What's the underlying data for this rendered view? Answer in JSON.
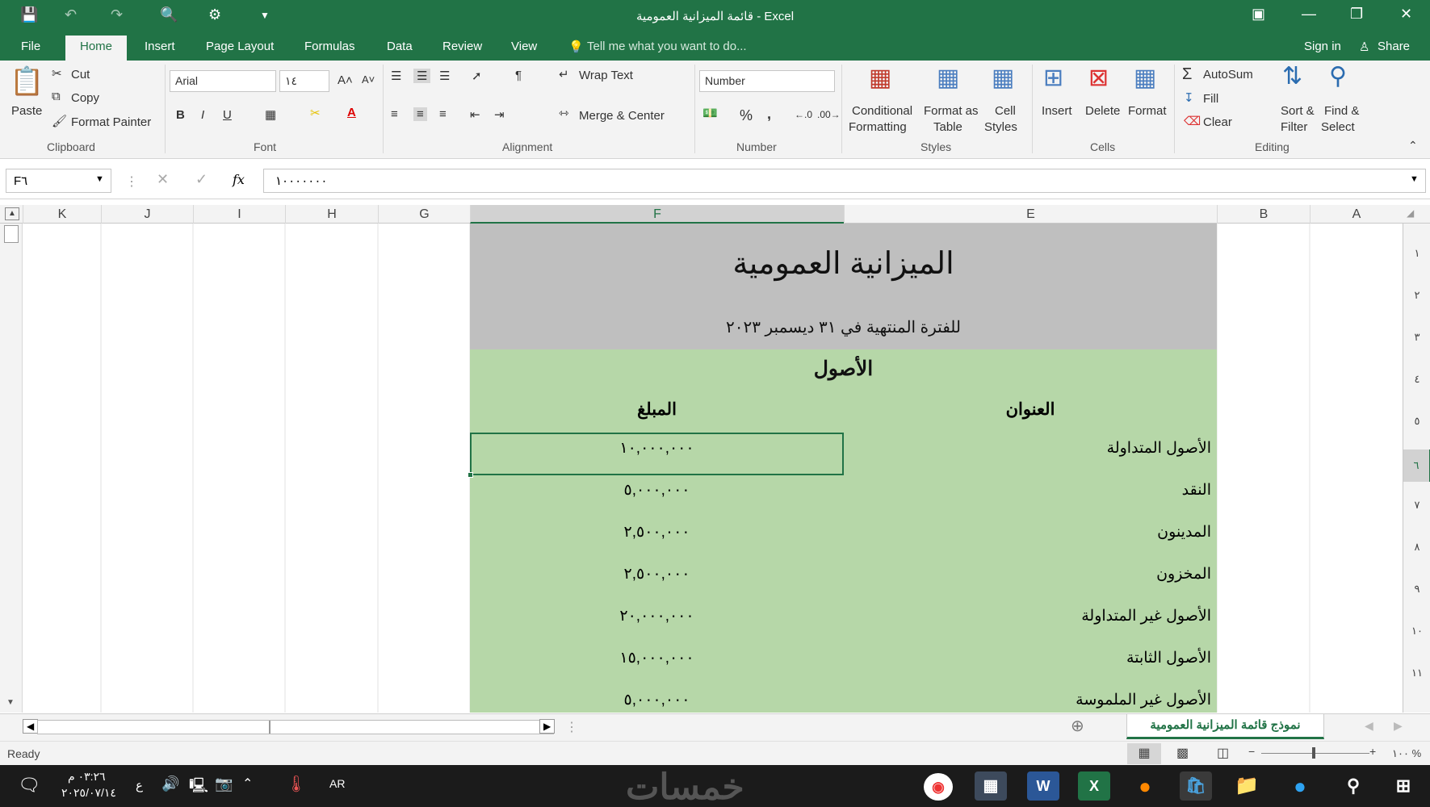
{
  "window": {
    "title": "قائمة الميزانية العمومية - Excel"
  },
  "menu": {
    "tabs": [
      "File",
      "Home",
      "Insert",
      "Page Layout",
      "Formulas",
      "Data",
      "Review",
      "View"
    ],
    "tell_me": "Tell me what you want to do...",
    "sign_in": "Sign in",
    "share": "Share"
  },
  "ribbon": {
    "clipboard": {
      "paste": "Paste",
      "cut": "Cut",
      "copy": "Copy",
      "format_painter": "Format Painter",
      "group": "Clipboard"
    },
    "font": {
      "name": "Arial",
      "size": "١٤",
      "bold": "B",
      "italic": "I",
      "underline": "U",
      "group": "Font"
    },
    "alignment": {
      "wrap_text": "Wrap Text",
      "merge_center": "Merge & Center",
      "group": "Alignment"
    },
    "number": {
      "format": "Number",
      "percent": "%",
      "comma": ",",
      "group": "Number"
    },
    "styles": {
      "conditional": "Conditional",
      "formatting": "Formatting",
      "format_as": "Format as",
      "table": "Table",
      "cell": "Cell",
      "cell_styles": "Styles",
      "group": "Styles"
    },
    "cells": {
      "insert": "Insert",
      "delete": "Delete",
      "format": "Format",
      "group": "Cells"
    },
    "editing": {
      "autosum": "AutoSum",
      "fill": "Fill",
      "clear": "Clear",
      "sort": "Sort &",
      "filter": "Filter",
      "find": "Find &",
      "select": "Select",
      "group": "Editing"
    }
  },
  "formula_bar": {
    "name_box": "F٦",
    "fx": "fx",
    "value": "١٠٠٠٠٠٠٠"
  },
  "columns": [
    "K",
    "J",
    "I",
    "H",
    "G",
    "F",
    "E",
    "B",
    "A"
  ],
  "rows": [
    "١",
    "٢",
    "٣",
    "٤",
    "٥",
    "٦",
    "٧",
    "٨",
    "٩",
    "١٠",
    "١١"
  ],
  "sheet": {
    "title": "الميزانية العمومية",
    "subtitle": "للفترة المنتهية في ٣١ ديسمبر ٢٠٢٣",
    "section": "الأصول",
    "header_label": "العنوان",
    "header_amount": "المبلغ",
    "rows": [
      {
        "label": "الأصول المتداولة",
        "amount": "١٠,٠٠٠,٠٠٠"
      },
      {
        "label": "النقد",
        "amount": "٥,٠٠٠,٠٠٠"
      },
      {
        "label": "المدينون",
        "amount": "٢,٥٠٠,٠٠٠"
      },
      {
        "label": "المخزون",
        "amount": "٢,٥٠٠,٠٠٠"
      },
      {
        "label": "الأصول غير المتداولة",
        "amount": "٢٠,٠٠٠,٠٠٠"
      },
      {
        "label": "الأصول الثابتة",
        "amount": "١٥,٠٠٠,٠٠٠"
      },
      {
        "label": "الأصول غير الملموسة",
        "amount": "٥,٠٠٠,٠٠٠"
      }
    ],
    "colors": {
      "header_fill": "#bfbfbf",
      "body_fill": "#b6d7a8",
      "accent": "#217346"
    }
  },
  "sheet_tab": "نموذج قائمة الميزانية العمومية",
  "status": {
    "ready": "Ready",
    "zoom": "١٠٠ %"
  },
  "taskbar": {
    "time": "٠٣:٢٦ م",
    "date": "٢٠٢٥/٠٧/١٤",
    "lang": "AR",
    "input": "ع",
    "watermark": "خمسات"
  }
}
